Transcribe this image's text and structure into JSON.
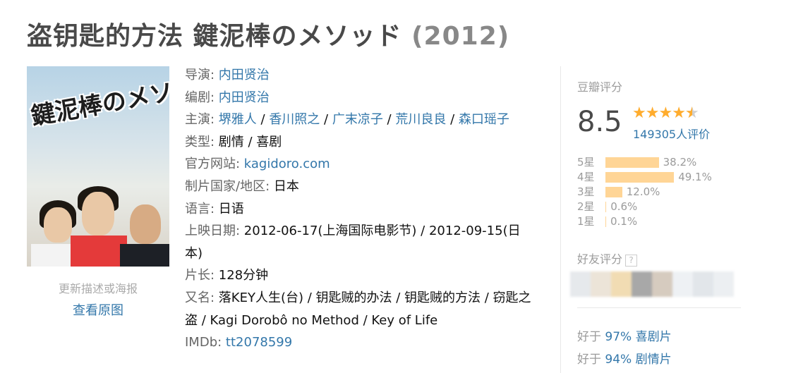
{
  "title": {
    "main": "盗钥匙的方法 鍵泥棒のメソッド",
    "year": "(2012)"
  },
  "poster": {
    "title_text": "鍵泥棒のメソッド",
    "update_text": "更新描述或海报",
    "view_original": "查看原图"
  },
  "info": {
    "director_label": "导演",
    "director": "内田贤治",
    "writer_label": "编剧",
    "writer": "内田贤治",
    "cast_label": "主演",
    "cast": [
      "堺雅人",
      "香川照之",
      "广末凉子",
      "荒川良良",
      "森口瑶子"
    ],
    "genre_label": "类型",
    "genre": "剧情 / 喜剧",
    "website_label": "官方网站",
    "website": "kagidoro.com",
    "country_label": "制片国家/地区",
    "country": "日本",
    "language_label": "语言",
    "language": "日语",
    "release_label": "上映日期",
    "release": "2012-06-17(上海国际电影节) / 2012-09-15(日本)",
    "runtime_label": "片长",
    "runtime": "128分钟",
    "aka_label": "又名",
    "aka": "落KEY人生(台) / 钥匙贼的办法 / 钥匙贼的方法 / 窃匙之盗 / Kagi Dorobô no Method / Key of Life",
    "imdb_label": "IMDb",
    "imdb": "tt2078599"
  },
  "rating": {
    "label": "豆瓣评分",
    "score": "8.5",
    "stars_value": 4.5,
    "votes": "149305人评价",
    "distribution": [
      {
        "label": "5星",
        "percent_text": "38.2%",
        "percent": 38.2
      },
      {
        "label": "4星",
        "percent_text": "49.1%",
        "percent": 49.1
      },
      {
        "label": "3星",
        "percent_text": "12.0%",
        "percent": 12.0
      },
      {
        "label": "2星",
        "percent_text": "0.6%",
        "percent": 0.6
      },
      {
        "label": "1星",
        "percent_text": "0.1%",
        "percent": 0.1
      }
    ]
  },
  "friends": {
    "label": "好友评分",
    "help": "?"
  },
  "better_than": [
    {
      "prefix": "好于",
      "percent": "97%",
      "genre": "喜剧片"
    },
    {
      "prefix": "好于",
      "percent": "94%",
      "genre": "剧情片"
    }
  ],
  "colors": {
    "link": "#3377aa",
    "star": "#ffac2d",
    "bar": "#ffd596",
    "muted": "#9b9b9b",
    "title": "#494949"
  }
}
